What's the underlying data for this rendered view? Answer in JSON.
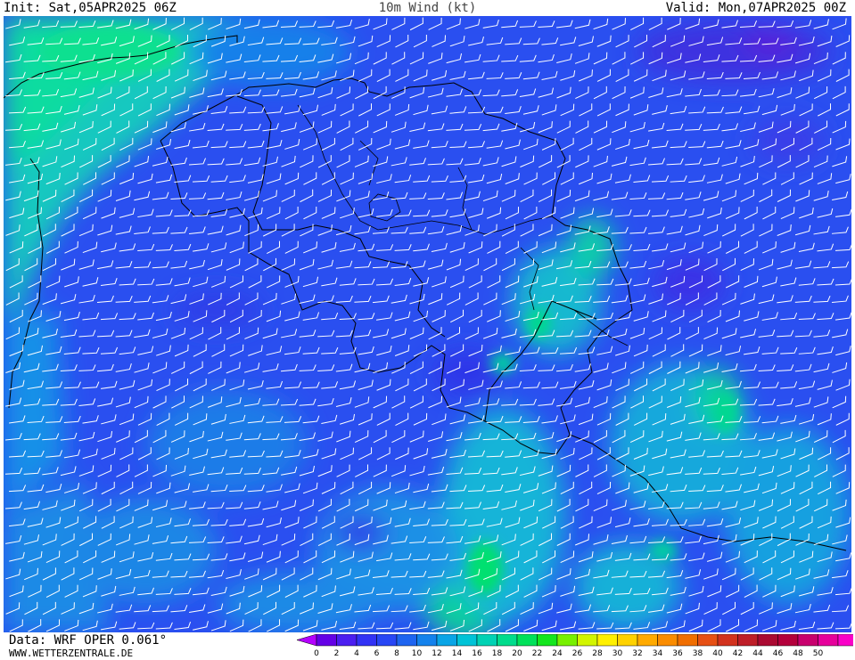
{
  "header": {
    "init": "Init: Sat,05APR2025 06Z",
    "title": "10m  Wind  (kt)",
    "valid": "Valid: Mon,07APR2025 00Z"
  },
  "footer": {
    "data_source": "Data: WRF OPER 0.061°",
    "website": "WWW.WETTERZENTRALE.DE"
  },
  "legend": {
    "labels": [
      "0",
      "2",
      "4",
      "6",
      "8",
      "10",
      "12",
      "14",
      "16",
      "18",
      "20",
      "22",
      "24",
      "26",
      "28",
      "30",
      "32",
      "34",
      "36",
      "38",
      "40",
      "42",
      "44",
      "46",
      "48",
      "50"
    ],
    "colors": [
      "#6400e6",
      "#4b1ef0",
      "#3232f5",
      "#2846f5",
      "#1e64f0",
      "#1482ec",
      "#0aa5e6",
      "#00c3d7",
      "#00d2b4",
      "#00dc8c",
      "#00e15a",
      "#14e61e",
      "#78f000",
      "#d2f500",
      "#fff000",
      "#ffd200",
      "#ffaa00",
      "#fa8c00",
      "#f06e00",
      "#e65014",
      "#d2321e",
      "#be1e28",
      "#aa0a32",
      "#b4003c",
      "#c8006e",
      "#e6009b",
      "#fa00c8"
    ],
    "under_color": "#b400ff",
    "over_color": "#ff00dc"
  },
  "map": {
    "wind_direction_deg": 255
  }
}
